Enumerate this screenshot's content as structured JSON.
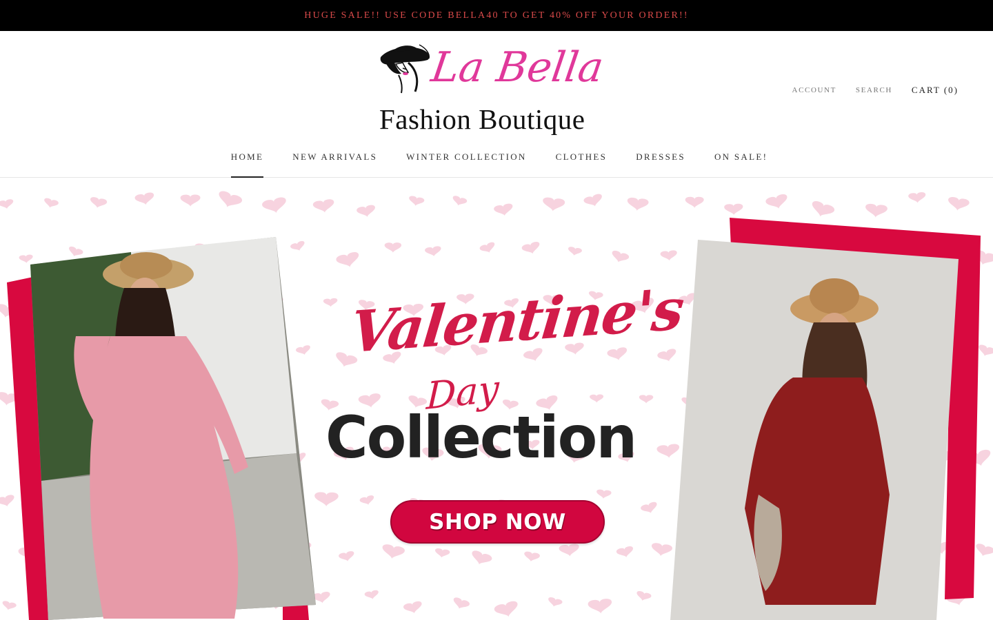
{
  "announcement": {
    "text": "HUGE SALE!! USE CODE BELLA40 TO GET 40% OFF YOUR ORDER!!"
  },
  "logo": {
    "script": "La Bella",
    "subtitle": "Fashion Boutique"
  },
  "util_nav": {
    "account": "ACCOUNT",
    "search": "SEARCH",
    "cart": "CART (0)"
  },
  "main_nav": {
    "items": [
      {
        "label": "HOME",
        "active": true
      },
      {
        "label": "NEW ARRIVALS"
      },
      {
        "label": "WINTER COLLECTION"
      },
      {
        "label": "CLOTHES"
      },
      {
        "label": "DRESSES"
      },
      {
        "label": "ON SALE!"
      }
    ]
  },
  "hero": {
    "title_script": "Valentine's",
    "title_day": "Day",
    "title_collection": "Collection",
    "cta": "SHOP NOW"
  },
  "colors": {
    "announcement_bg": "#000000",
    "announcement_text": "#d94a4a",
    "logo_pink": "#e0389a",
    "hero_red": "#d21c4a",
    "cta_red": "#d1063f",
    "heart_pink": "#f7d3df"
  }
}
